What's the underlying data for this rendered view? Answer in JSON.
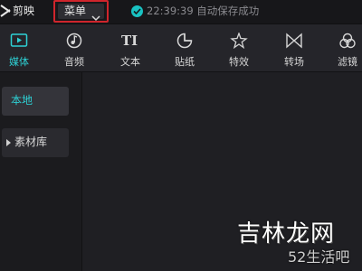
{
  "titlebar": {
    "app_name": "剪映",
    "menu_label": "菜单",
    "save_status": "22:39:39 自动保存成功",
    "accent_color": "#2ed0d4",
    "highlight_color": "#d0252c"
  },
  "toolbar": {
    "items": [
      {
        "label": "媒体",
        "icon": "media-icon",
        "active": true
      },
      {
        "label": "音频",
        "icon": "audio-icon",
        "active": false
      },
      {
        "label": "文本",
        "icon": "text-icon",
        "active": false
      },
      {
        "label": "贴纸",
        "icon": "sticker-icon",
        "active": false
      },
      {
        "label": "特效",
        "icon": "effects-icon",
        "active": false
      },
      {
        "label": "转场",
        "icon": "transition-icon",
        "active": false
      },
      {
        "label": "滤镜",
        "icon": "filter-icon",
        "active": false
      }
    ]
  },
  "sidebar": {
    "items": [
      {
        "label": "本地",
        "active": true
      },
      {
        "label": "素材库",
        "active": false
      }
    ]
  },
  "watermark": {
    "line1": "吉林龙网",
    "line2": "52生活吧"
  }
}
